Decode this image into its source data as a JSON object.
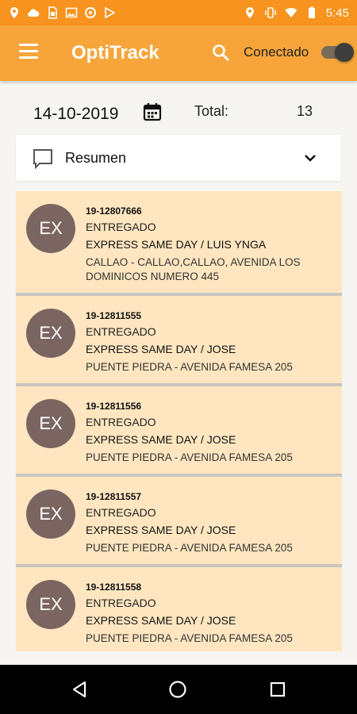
{
  "status_bar": {
    "time": "5:45",
    "left_icons": [
      "location-icon",
      "cloud-icon",
      "sim-card-icon",
      "image-icon",
      "circle-icon",
      "play-store-icon"
    ],
    "right_icons": [
      "location-icon",
      "vibrate-icon",
      "wifi-icon",
      "battery-icon"
    ]
  },
  "app_bar": {
    "title": "OptiTrack",
    "connection_label": "Conectado",
    "connected": true
  },
  "filter": {
    "date": "14-10-2019",
    "total_label": "Total:",
    "total_value": "13"
  },
  "summary": {
    "label": "Resumen"
  },
  "shipments": [
    {
      "avatar": "EX",
      "id": "19-12807666",
      "status": "ENTREGADO",
      "service": "EXPRESS SAME DAY / LUIS YNGA",
      "address": "CALLAO - CALLAO,CALLAO, AVENIDA LOS DOMINICOS NUMERO 445"
    },
    {
      "avatar": "EX",
      "id": "19-12811555",
      "status": "ENTREGADO",
      "service": "EXPRESS SAME DAY / JOSE",
      "address": "PUENTE PIEDRA - AVENIDA FAMESA 205"
    },
    {
      "avatar": "EX",
      "id": "19-12811556",
      "status": "ENTREGADO",
      "service": "EXPRESS SAME DAY / JOSE",
      "address": "PUENTE PIEDRA - AVENIDA FAMESA 205"
    },
    {
      "avatar": "EX",
      "id": "19-12811557",
      "status": "ENTREGADO",
      "service": "EXPRESS SAME DAY / JOSE",
      "address": "PUENTE PIEDRA - AVENIDA FAMESA 205"
    },
    {
      "avatar": "EX",
      "id": "19-12811558",
      "status": "ENTREGADO",
      "service": "EXPRESS SAME DAY / JOSE",
      "address": "PUENTE PIEDRA - AVENIDA FAMESA 205"
    }
  ],
  "colors": {
    "status_bar": "#f7931e",
    "app_bar": "#f7a53a",
    "card_background": "#ffe6c0",
    "avatar_background": "#7b6561",
    "page_background": "#f6f5f1"
  },
  "nav_bar": {
    "icons": [
      "back-icon",
      "home-icon",
      "recent-apps-icon"
    ]
  }
}
